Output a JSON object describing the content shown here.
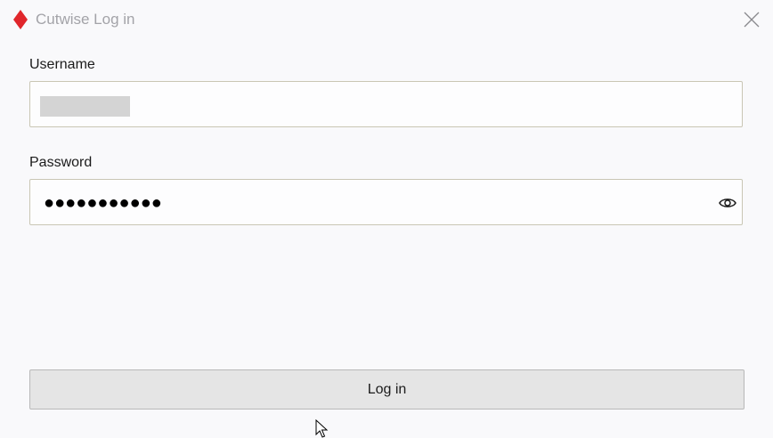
{
  "window": {
    "title": "Cutwise Log in",
    "app_icon": "red-diamond-icon",
    "close_icon": "close-icon"
  },
  "form": {
    "username_label": "Username",
    "username_value": "",
    "password_label": "Password",
    "password_value": "●●●●●●●●●●●",
    "reveal_icon": "eye-icon"
  },
  "actions": {
    "login_label": "Log in"
  },
  "colors": {
    "brand_red": "#e0262b",
    "title_gray": "#a3a3a8",
    "button_bg": "#e5e5e5"
  }
}
